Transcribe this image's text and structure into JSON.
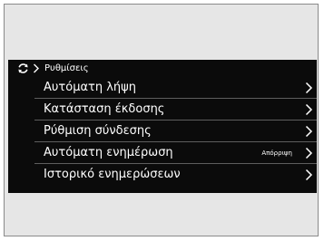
{
  "breadcrumb": {
    "icon": "refresh-icon",
    "separator_icon": "chevron-right-icon",
    "label": "Ρυθμίσεις"
  },
  "menu": {
    "items": [
      {
        "label": "Αυτόματη λήψη",
        "value": "",
        "icon": "chevron-right-icon"
      },
      {
        "label": "Κατάσταση έκδοσης",
        "value": "",
        "icon": "chevron-right-icon"
      },
      {
        "label": "Ρύθμιση σύνδεσης",
        "value": "",
        "icon": "chevron-right-icon"
      },
      {
        "label": "Αυτόματη ενημέρωση",
        "value": "Απόρριψη",
        "icon": "chevron-right-icon"
      },
      {
        "label": "Ιστορικό ενημερώσεων",
        "value": "",
        "icon": "chevron-right-icon"
      }
    ]
  },
  "colors": {
    "panel_background": "#0b0b0b",
    "outer_background": "#e6e6e6",
    "divider": "#5e5e5e",
    "text": "#ffffff"
  }
}
